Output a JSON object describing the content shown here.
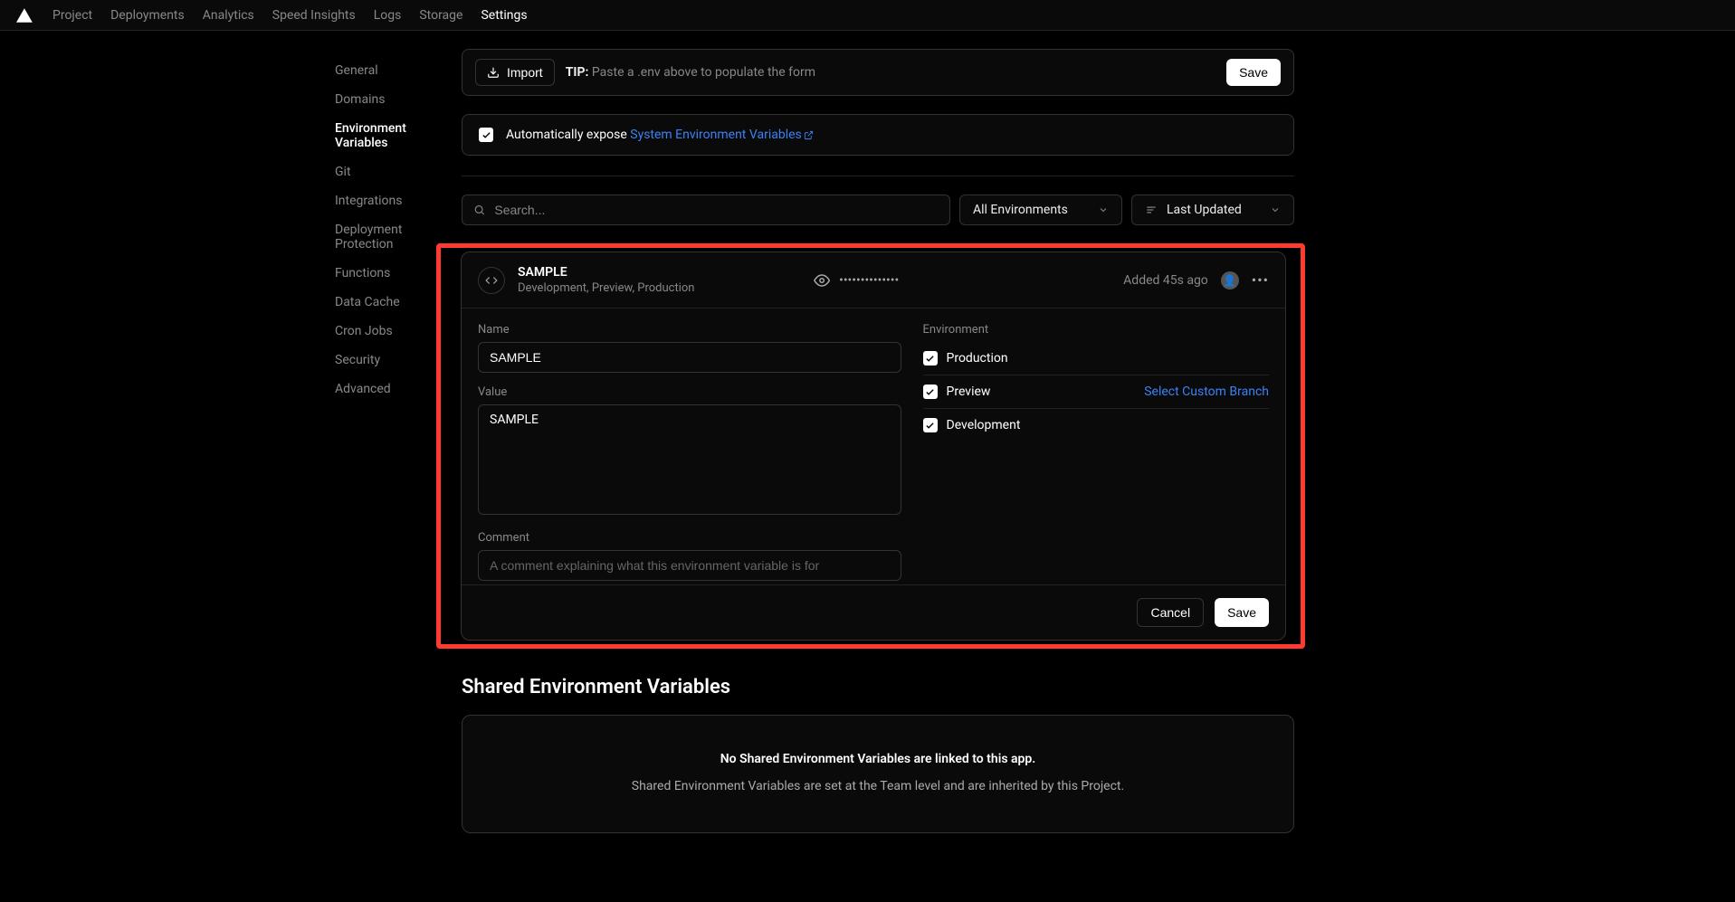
{
  "nav": {
    "items": [
      "Project",
      "Deployments",
      "Analytics",
      "Speed Insights",
      "Logs",
      "Storage",
      "Settings"
    ],
    "active": "Settings"
  },
  "sidebar": {
    "items": [
      "General",
      "Domains",
      "Environment Variables",
      "Git",
      "Integrations",
      "Deployment Protection",
      "Functions",
      "Data Cache",
      "Cron Jobs",
      "Security",
      "Advanced"
    ],
    "active": "Environment Variables"
  },
  "importRow": {
    "import": "Import",
    "tipLabel": "TIP:",
    "tipText": "Paste a .env above to populate the form",
    "save": "Save"
  },
  "expose": {
    "prefix": "Automatically expose ",
    "link": "System Environment Variables"
  },
  "filters": {
    "searchPlaceholder": "Search...",
    "env": "All Environments",
    "sort": "Last Updated"
  },
  "variable": {
    "name": "SAMPLE",
    "envs": "Development, Preview, Production",
    "masked": "••••••••••••••",
    "added": "Added 45s ago",
    "fields": {
      "nameLabel": "Name",
      "nameValue": "SAMPLE",
      "valueLabel": "Value",
      "valueValue": "SAMPLE",
      "commentLabel": "Comment",
      "commentPlaceholder": "A comment explaining what this environment variable is for"
    },
    "envLabel": "Environment",
    "envOptions": {
      "prod": "Production",
      "preview": "Preview",
      "dev": "Development",
      "customBranch": "Select Custom Branch"
    },
    "cancel": "Cancel",
    "save": "Save"
  },
  "shared": {
    "title": "Shared Environment Variables",
    "heading": "No Shared Environment Variables are linked to this app.",
    "sub": "Shared Environment Variables are set at the Team level and are inherited by this Project."
  }
}
